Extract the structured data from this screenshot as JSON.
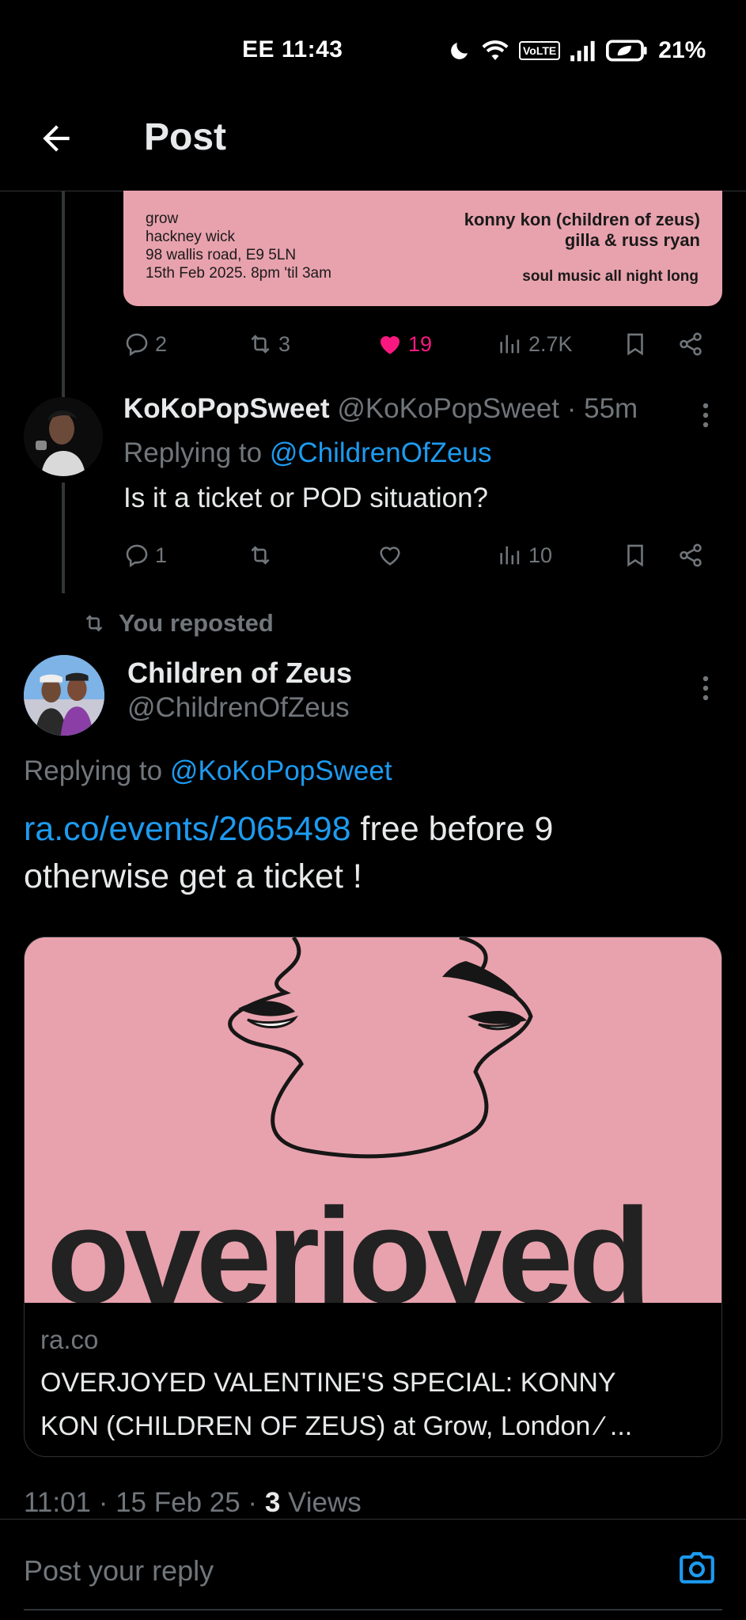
{
  "status_bar": {
    "carrier": "EE",
    "time": "11:43",
    "volte": "VoLTE",
    "battery": "21%"
  },
  "header": {
    "title": "Post"
  },
  "poster": {
    "venue_lines": [
      "grow",
      "hackney wick",
      "98 wallis road, E9 5LN",
      "15th Feb 2025. 8pm 'til 3am"
    ],
    "artists": [
      "konny kon (children of zeus)",
      "gilla & russ ryan"
    ],
    "tagline": "soul music all night long"
  },
  "top_actions": {
    "replies": "2",
    "reposts": "3",
    "likes": "19",
    "views": "2.7K"
  },
  "reply_post": {
    "name": "KoKoPopSweet",
    "handle_time": "@KoKoPopSweet · 55m",
    "replying_label": "Replying to",
    "replying_mention": "@ChildrenOfZeus",
    "text": "Is it a ticket or POD situation?",
    "actions": {
      "replies": "1",
      "views": "10"
    }
  },
  "repost_label": "You reposted",
  "main_post": {
    "name": "Children of Zeus",
    "handle": "@ChildrenOfZeus",
    "replying_label": "Replying to",
    "replying_mention": "@KoKoPopSweet",
    "text_link": "ra.co/events/2065498",
    "text_rest_1": " free before 9",
    "text_rest_2": "otherwise get a ticket !",
    "card": {
      "image_word": "overjoyed",
      "domain": "ra.co",
      "title_line1": "OVERJOYED VALENTINE'S SPECIAL: KONNY",
      "title_line2": "KON (CHILDREN OF ZEUS) at Grow, London ⁄ ..."
    },
    "time": "11:01 · 15 Feb 25 · ",
    "views_count": "3",
    "views_label": " Views"
  },
  "reply_bar": {
    "placeholder": "Post your reply"
  },
  "colors": {
    "accent": "#1d9bf0",
    "like": "#f91880",
    "muted": "#71767b",
    "poster_pink": "#e8a2ad"
  }
}
